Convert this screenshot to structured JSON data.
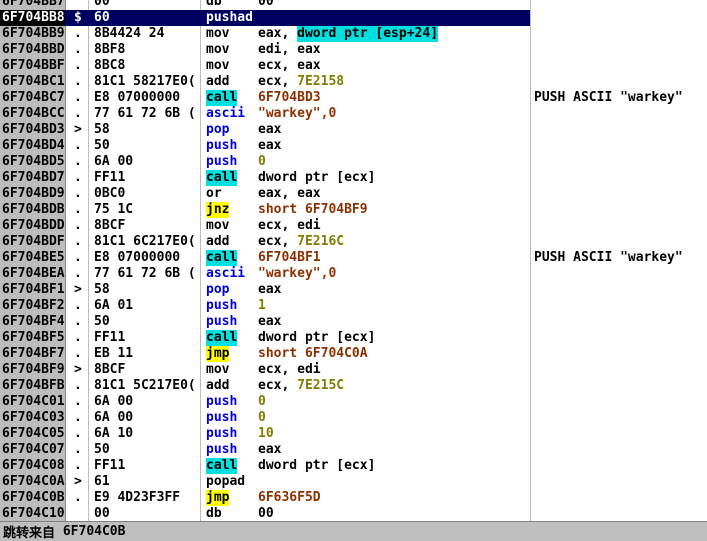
{
  "app": {
    "view": "disassembly"
  },
  "colors": {
    "selection_bg": "#000060",
    "selection_address_bg": "#000000",
    "address_column_bg": "#bcbcbc",
    "call_highlight": "#00e0e0",
    "jump_highlight": "#ffff00",
    "operand_highlight": "#00e0e0",
    "push_pop_mnemonic": "#0000d8",
    "constant_color": "#7e7e00",
    "address_operand_color": "#8b3000"
  },
  "disasm": {
    "rows": [
      {
        "addr": "6F704BB7",
        "mark": "",
        "bytes": "00",
        "mn": "db",
        "ops": [
          {
            "t": "00"
          }
        ]
      },
      {
        "addr": "6F704BB8",
        "mark": "$",
        "bytes": "60",
        "mn": "pushad",
        "ops": [],
        "sel": true
      },
      {
        "addr": "6F704BB9",
        "mark": ".",
        "bytes": "8B4424 24",
        "mn": "mov",
        "ops": [
          {
            "t": "eax, "
          },
          {
            "t": "dword ptr [esp+24]",
            "bg": "c"
          }
        ]
      },
      {
        "addr": "6F704BBD",
        "mark": ".",
        "bytes": "8BF8",
        "mn": "mov",
        "ops": [
          {
            "t": "edi, eax"
          }
        ]
      },
      {
        "addr": "6F704BBF",
        "mark": ".",
        "bytes": "8BC8",
        "mn": "mov",
        "ops": [
          {
            "t": "ecx, eax"
          }
        ]
      },
      {
        "addr": "6F704BC1",
        "mark": ".",
        "bytes": "81C1 58217E0(",
        "mn": "add",
        "ops": [
          {
            "t": "ecx, "
          },
          {
            "t": "7E2158",
            "c": "o"
          }
        ]
      },
      {
        "addr": "6F704BC7",
        "mark": ".",
        "bytes": "E8 07000000",
        "mn": "call",
        "mnbg": "c",
        "ops": [
          {
            "t": "6F704BD3",
            "c": "r"
          }
        ],
        "comment": "PUSH ASCII \"warkey\""
      },
      {
        "addr": "6F704BCC",
        "mark": ".",
        "bytes": "77 61 72 6B (",
        "mn": "ascii",
        "mnc": "b",
        "ops": [
          {
            "t": "\"warkey\",0",
            "c": "r"
          }
        ]
      },
      {
        "addr": "6F704BD3",
        "mark": ">",
        "bytes": "58",
        "mn": "pop",
        "mnc": "b",
        "ops": [
          {
            "t": "eax"
          }
        ]
      },
      {
        "addr": "6F704BD4",
        "mark": ".",
        "bytes": "50",
        "mn": "push",
        "mnc": "b",
        "ops": [
          {
            "t": "eax"
          }
        ]
      },
      {
        "addr": "6F704BD5",
        "mark": ".",
        "bytes": "6A 00",
        "mn": "push",
        "mnc": "b",
        "ops": [
          {
            "t": "0",
            "c": "o"
          }
        ]
      },
      {
        "addr": "6F704BD7",
        "mark": ".",
        "bytes": "FF11",
        "mn": "call",
        "mnbg": "c",
        "ops": [
          {
            "t": "dword ptr [ecx]"
          }
        ]
      },
      {
        "addr": "6F704BD9",
        "mark": ".",
        "bytes": "0BC0",
        "mn": "or",
        "ops": [
          {
            "t": "eax, eax"
          }
        ]
      },
      {
        "addr": "6F704BDB",
        "mark": ".",
        "bytes": "75 1C",
        "mn": "jnz",
        "mnbg": "y",
        "ops": [
          {
            "t": "short 6F704BF9",
            "c": "r"
          }
        ]
      },
      {
        "addr": "6F704BDD",
        "mark": ".",
        "bytes": "8BCF",
        "mn": "mov",
        "ops": [
          {
            "t": "ecx, edi"
          }
        ]
      },
      {
        "addr": "6F704BDF",
        "mark": ".",
        "bytes": "81C1 6C217E0(",
        "mn": "add",
        "ops": [
          {
            "t": "ecx, "
          },
          {
            "t": "7E216C",
            "c": "o"
          }
        ]
      },
      {
        "addr": "6F704BE5",
        "mark": ".",
        "bytes": "E8 07000000",
        "mn": "call",
        "mnbg": "c",
        "ops": [
          {
            "t": "6F704BF1",
            "c": "r"
          }
        ],
        "comment": "PUSH ASCII \"warkey\""
      },
      {
        "addr": "6F704BEA",
        "mark": ".",
        "bytes": "77 61 72 6B (",
        "mn": "ascii",
        "mnc": "b",
        "ops": [
          {
            "t": "\"warkey\",0",
            "c": "r"
          }
        ]
      },
      {
        "addr": "6F704BF1",
        "mark": ">",
        "bytes": "58",
        "mn": "pop",
        "mnc": "b",
        "ops": [
          {
            "t": "eax"
          }
        ]
      },
      {
        "addr": "6F704BF2",
        "mark": ".",
        "bytes": "6A 01",
        "mn": "push",
        "mnc": "b",
        "ops": [
          {
            "t": "1",
            "c": "o"
          }
        ]
      },
      {
        "addr": "6F704BF4",
        "mark": ".",
        "bytes": "50",
        "mn": "push",
        "mnc": "b",
        "ops": [
          {
            "t": "eax"
          }
        ]
      },
      {
        "addr": "6F704BF5",
        "mark": ".",
        "bytes": "FF11",
        "mn": "call",
        "mnbg": "c",
        "ops": [
          {
            "t": "dword ptr [ecx]"
          }
        ]
      },
      {
        "addr": "6F704BF7",
        "mark": ".",
        "bytes": "EB 11",
        "mn": "jmp",
        "mnbg": "y",
        "ops": [
          {
            "t": "short 6F704C0A",
            "c": "r"
          }
        ]
      },
      {
        "addr": "6F704BF9",
        "mark": ">",
        "bytes": "8BCF",
        "mn": "mov",
        "ops": [
          {
            "t": "ecx, edi"
          }
        ]
      },
      {
        "addr": "6F704BFB",
        "mark": ".",
        "bytes": "81C1 5C217E0(",
        "mn": "add",
        "ops": [
          {
            "t": "ecx, "
          },
          {
            "t": "7E215C",
            "c": "o"
          }
        ]
      },
      {
        "addr": "6F704C01",
        "mark": ".",
        "bytes": "6A 00",
        "mn": "push",
        "mnc": "b",
        "ops": [
          {
            "t": "0",
            "c": "o"
          }
        ]
      },
      {
        "addr": "6F704C03",
        "mark": ".",
        "bytes": "6A 00",
        "mn": "push",
        "mnc": "b",
        "ops": [
          {
            "t": "0",
            "c": "o"
          }
        ]
      },
      {
        "addr": "6F704C05",
        "mark": ".",
        "bytes": "6A 10",
        "mn": "push",
        "mnc": "b",
        "ops": [
          {
            "t": "10",
            "c": "o"
          }
        ]
      },
      {
        "addr": "6F704C07",
        "mark": ".",
        "bytes": "50",
        "mn": "push",
        "mnc": "b",
        "ops": [
          {
            "t": "eax"
          }
        ]
      },
      {
        "addr": "6F704C08",
        "mark": ".",
        "bytes": "FF11",
        "mn": "call",
        "mnbg": "c",
        "ops": [
          {
            "t": "dword ptr [ecx]"
          }
        ]
      },
      {
        "addr": "6F704C0A",
        "mark": ">",
        "bytes": "61",
        "mn": "popad",
        "ops": []
      },
      {
        "addr": "6F704C0B",
        "mark": ".",
        "bytes": "E9 4D23F3FF",
        "mn": "jmp",
        "mnbg": "y",
        "ops": [
          {
            "t": "6F636F5D",
            "c": "r"
          }
        ]
      },
      {
        "addr": "6F704C10",
        "mark": "",
        "bytes": "00",
        "mn": "db",
        "ops": [
          {
            "t": "00"
          }
        ]
      }
    ]
  },
  "statusbar": {
    "label": "跳转来自",
    "address": "6F704C0B"
  }
}
